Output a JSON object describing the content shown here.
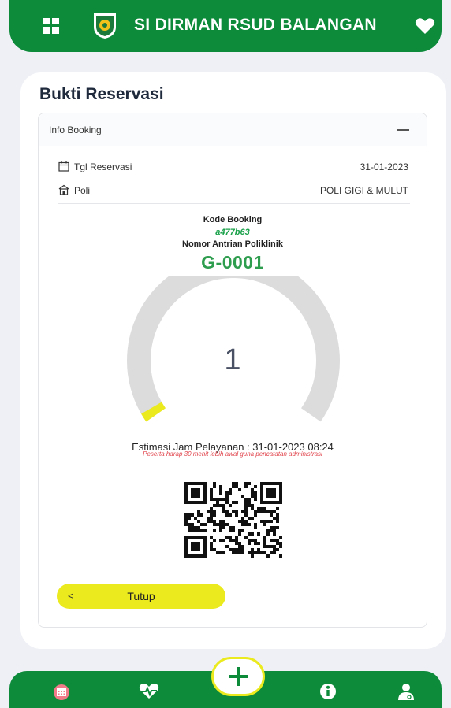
{
  "header": {
    "app_title": "SI DIRMAN RSUD BALANGAN",
    "menu_icon": "grid-icon",
    "logo_icon": "hospital-emblem-icon",
    "favorite_icon": "heart-icon"
  },
  "page": {
    "title": "Bukti Reservasi"
  },
  "booking_card": {
    "header_label": "Info Booking",
    "collapse_icon": "minus-icon",
    "rows": [
      {
        "icon": "calendar-icon",
        "label": "Tgl Reservasi",
        "value": "31-01-2023"
      },
      {
        "icon": "building-icon",
        "label": "Poli",
        "value": "POLI GIGI & MULUT"
      }
    ],
    "kode_booking_label": "Kode Booking",
    "kode_booking_value": "a477b63",
    "nomor_antrian_label": "Nomor Antrian Poliklinik",
    "nomor_antrian_value": "G-0001",
    "gauge": {
      "value": "1",
      "progress_fraction": 0.02
    },
    "estimasi_text": "Estimasi Jam Pelayanan : 31-01-2023 08:24",
    "note_text": "Peserta harap 30 menit lebih awal guna pencatatan administrasi",
    "close_button_label": "Tutup",
    "close_button_chevron": "<"
  },
  "bottom_nav": {
    "items": [
      {
        "name": "calendar-nav-icon"
      },
      {
        "name": "heartbeat-nav-icon"
      },
      {
        "name": "add-button-icon"
      },
      {
        "name": "info-nav-icon"
      },
      {
        "name": "doctor-nav-icon"
      }
    ]
  },
  "colors": {
    "primary_green": "#0d8a3a",
    "accent_yellow": "#eaea1e",
    "queue_green": "#2e9d4e",
    "note_red": "#e0424a",
    "gauge_track": "#dcdcdc"
  }
}
